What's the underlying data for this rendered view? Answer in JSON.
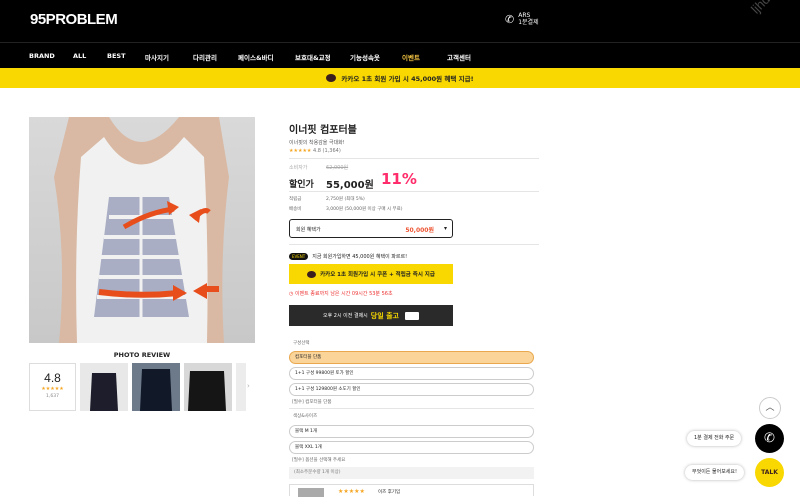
{
  "header": {
    "logo": "95PROBLEM",
    "ars_line1": "ARS",
    "ars_line2": "1분결제",
    "watermark": "ljhdlu"
  },
  "nav": {
    "items": [
      "BRAND",
      "ALL",
      "BEST",
      "마사지기",
      "다리관리",
      "페이스&바디",
      "보호대&교정",
      "기능성속옷",
      "이벤트",
      "고객센터"
    ]
  },
  "banner": {
    "text": "카카오 1초 회원 가입 시 45,000원 혜택 지급!"
  },
  "gallery": {
    "review_title": "PHOTO REVIEW",
    "rating": "4.8",
    "stars": "★★★★★",
    "count": "1,637",
    "next_arrow": "›"
  },
  "product": {
    "title": "이너핏 컴포터블",
    "subtitle": "이너핏의 착용감을 극대화!",
    "rating_stars": "★★★★★",
    "rating_text": "4.8 (1,364)",
    "consumer_price_label": "소비자가",
    "consumer_price": "62,000원",
    "sale_label": "할인가",
    "sale_price": "55,000원",
    "discount": "11%",
    "points_label": "적립금",
    "points_value": "2,750원 (최대 5%)",
    "shipping_label": "배송비",
    "shipping_value": "3,000원 (50,000원 이상 구매 시 무료)",
    "member_label": "회원 혜택가",
    "member_price": "50,000원",
    "member_chevron": "▾"
  },
  "event": {
    "badge": "EVENT",
    "text": "지금 회원가입하면 45,000원 혜택이 파르르!",
    "kakao_button": "카카오 1초 회원가입 시 쿠폰 + 적립금 즉시 지급",
    "timer": "이벤트 종료까지 남은 시간 09시간 53분 56초"
  },
  "delivery": {
    "text": "오후 2시 이전 결제시",
    "highlight": "당일 출고"
  },
  "options": {
    "composition_label": "구성선택",
    "composition": [
      "컴포터블 단품",
      "1+1 구성 99800원 토가 할인",
      "1+1 구성 129800원 소도기 할인"
    ],
    "composition_note": "[필수] 컴포터블 단품",
    "color_label": "색상&사이즈",
    "colors": [
      "블랙 M 1개",
      "블랙 XXL 1개"
    ],
    "color_note": "[필수] 옵션을 선택해 주세요",
    "minimum_note": "(최소주문수량 1개 이상)"
  },
  "review_preview": {
    "stars": "★★★★★",
    "text": "이즈 후기임"
  },
  "floating": {
    "scroll_top": "︿",
    "phone_order": "1분 결제 전화 주문",
    "ask": "무엇이든 물어보세요!",
    "phone_icon": "✆",
    "talk": "TALK"
  }
}
